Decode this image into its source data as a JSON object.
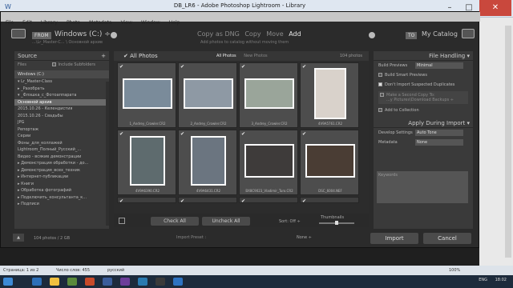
{
  "window": {
    "title": "DB_LR6 - Adobe Photoshop Lightroom - Library",
    "qat": "W",
    "controls": [
      "–",
      "□",
      "✕"
    ]
  },
  "menu": [
    "File",
    "Edit",
    "Library",
    "Photo",
    "Metadata",
    "View",
    "Window",
    "Help"
  ],
  "header": {
    "from_label": "FROM",
    "from_name": "Windows (C:) ÷",
    "from_path": "...\\Lr_Master-C... \\ Основной архив",
    "modes": [
      "Copy as DNG",
      "Copy",
      "Move",
      "Add"
    ],
    "active_mode": "Add",
    "mode_hint": "Add photos to catalog without moving them",
    "to_label": "TO",
    "to_name": "My Catalog"
  },
  "source": {
    "title": "Source",
    "files_label": "Files",
    "include_subfolders": "Include Subfolders",
    "drive": "Windows (C:)",
    "tree": [
      "▾ Lr_Master-Class",
      "  ▸ _Разобрать",
      "  ▾ _Флэшка_с_Фотоаппарата",
      "      Основной архив",
      "      2015.10.26 - Келендистия",
      "      2015.10.26 - Свадьбы",
      "      JPG",
      "      Репортаж",
      "      Серии",
      "      Фоны_для_коллажей",
      "  Lightroom_Полный_Русский_...",
      "  Видео - всякие демонстрации",
      "  ▸ Демонстрация обработки - до...",
      "  ▸ Демонстрация_всех_техник",
      "  ▸ Интернет-публикации",
      "  ▸ Книги",
      "  ▸ Обработка фотографий",
      "  ▸ Подключить_консультанта_к...",
      "  ▸ Подписи"
    ],
    "selected_index": 3
  },
  "center": {
    "title": "All Photos",
    "tabs": [
      "All Photos",
      "New Photos"
    ],
    "count": "104 photos",
    "photos": [
      {
        "name": "1_Andrey_Crowler.CR2",
        "color": "#7a8b9a",
        "checked": true
      },
      {
        "name": "2_Andrey_Crowler.CR2",
        "color": "#8e99a4",
        "checked": true
      },
      {
        "name": "3_Andrey_Crowler.CR2",
        "color": "#9aa59a",
        "checked": true
      },
      {
        "name": "4V9A5761.CR2",
        "color": "#d9d2cb",
        "checked": true
      },
      {
        "name": "4V9A6390.CR2",
        "color": "#5e6b6e",
        "checked": true
      },
      {
        "name": "4V9A6431.CR2",
        "color": "#6b7580",
        "checked": true
      },
      {
        "name": "BX8C9023_Vladimir_Turo.CR2",
        "color": "#3e3b3a",
        "checked": true
      },
      {
        "name": "DSC_6004.NEF",
        "color": "#4a3d34",
        "checked": true
      },
      {
        "name": "",
        "color": "#3a3a3a",
        "checked": true
      },
      {
        "name": "",
        "color": "#3a3a3a",
        "checked": true
      },
      {
        "name": "",
        "color": "#3a3a3a",
        "checked": true
      },
      {
        "name": "",
        "color": "#3a3a3a",
        "checked": true
      }
    ],
    "check_all": "Check All",
    "uncheck_all": "Uncheck All",
    "sort_label": "Sort:",
    "sort_value": "Off ÷",
    "thumbnails_label": "Thumbnails"
  },
  "right": {
    "file_handling": "File Handling ▾",
    "build_previews_label": "Build Previews",
    "build_previews_value": "Minimal",
    "smart_previews": "Build Smart Previews",
    "dont_import_dupes": "Don't Import Suspected Duplicates",
    "make_second_copy": "Make a Second Copy To:",
    "second_copy_path": "...y Pictures\\Download Backups ÷",
    "add_to_collection": "Add to Collection",
    "apply_during_import": "Apply During Import ▾",
    "develop_settings_label": "Develop Settings",
    "develop_settings_value": "Auto Tone",
    "metadata_label": "Metadata",
    "metadata_value": "None",
    "keywords_label": "Keywords"
  },
  "bottom": {
    "count": "104 photos / 2 GB",
    "import_preset_label": "Import Preset :",
    "import_preset_value": "None ÷",
    "import_btn": "Import",
    "cancel_btn": "Cancel"
  },
  "statusbar": {
    "page": "Страница: 1 из 2",
    "words": "Число слов: 455",
    "lang": "русский",
    "zoom": "100%"
  },
  "tray": {
    "lang": "ENG",
    "time": "18:02"
  }
}
